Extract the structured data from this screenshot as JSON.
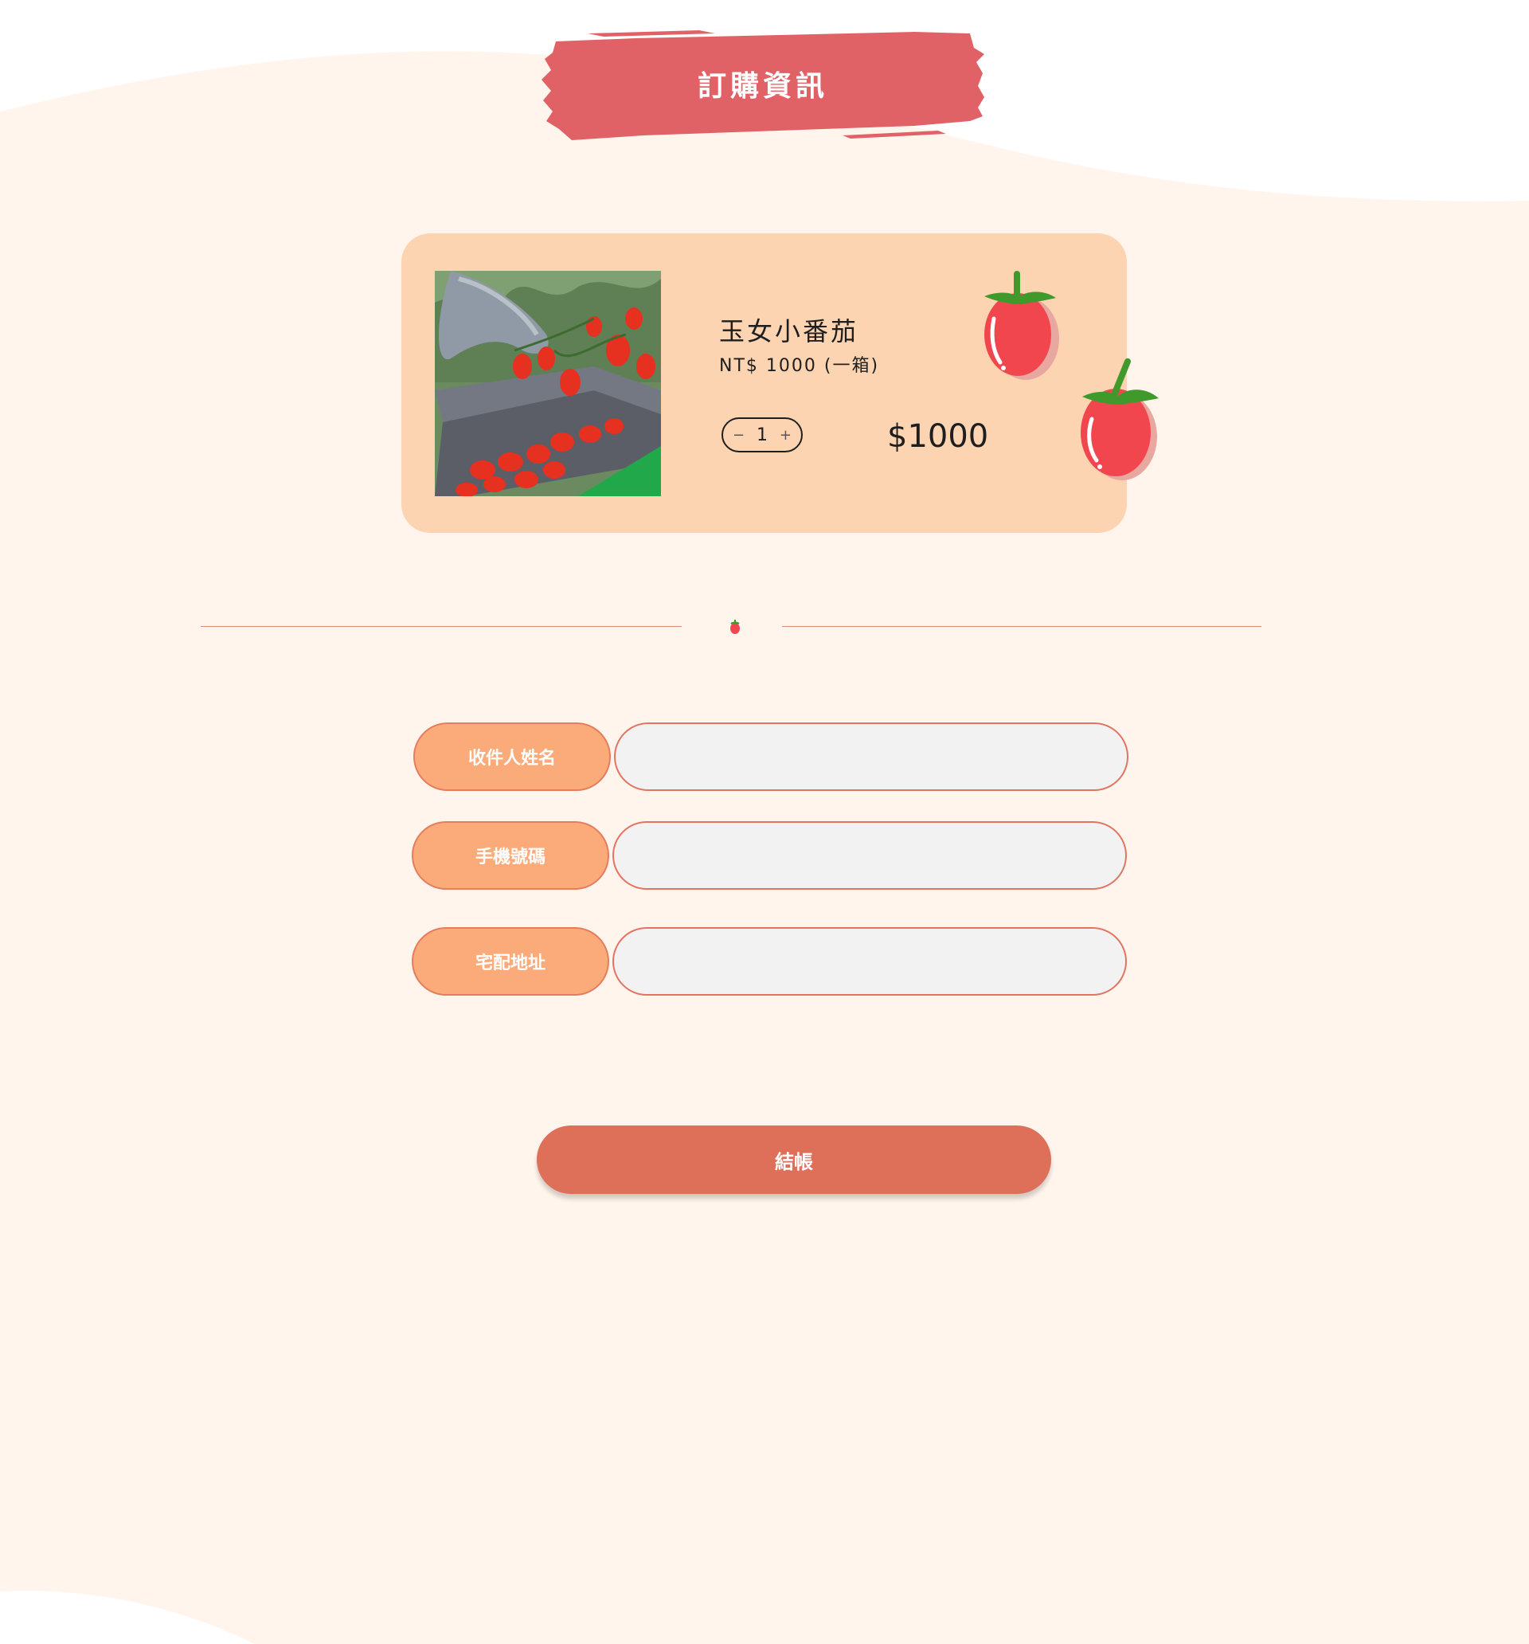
{
  "header": {
    "title": "訂購資訊"
  },
  "product": {
    "name": "玉女小番茄",
    "price_note": "NT$ 1000 (一箱)",
    "quantity": "1",
    "decrement_symbol": "−",
    "increment_symbol": "+",
    "subtotal": "$1000",
    "photo_icon": "tomato-harvest-photo"
  },
  "form": {
    "fields": [
      {
        "label": "收件人姓名",
        "value": "",
        "placeholder": ""
      },
      {
        "label": "手機號碼",
        "value": "",
        "placeholder": ""
      },
      {
        "label": "宅配地址",
        "value": "",
        "placeholder": ""
      }
    ],
    "submit_label": "結帳"
  },
  "colors": {
    "background": "#fff5ed",
    "title_brush": "#e06266",
    "card": "#fdd4b2",
    "label_fill": "#fbab7a",
    "input_border": "#e27461",
    "checkout_button": "#de6f59",
    "tomato_red": "#f2464f",
    "tomato_leaf": "#3f9a2b"
  }
}
